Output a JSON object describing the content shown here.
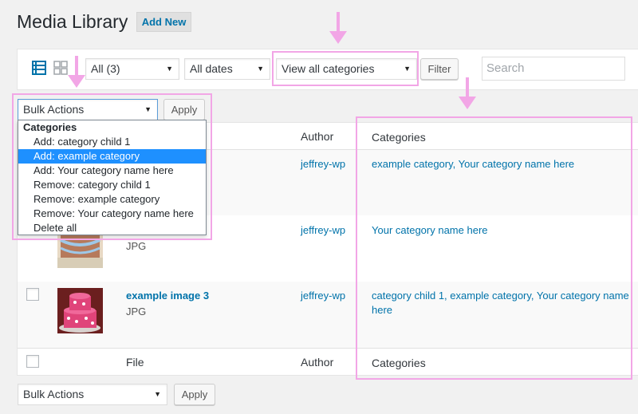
{
  "header": {
    "title": "Media Library",
    "add_new_label": "Add New"
  },
  "toolbar": {
    "type_filter": "All (3)",
    "date_filter": "All dates",
    "category_filter": "View all categories",
    "filter_button": "Filter",
    "search_placeholder": "Search"
  },
  "bulk_top": {
    "selected": "Bulk Actions",
    "apply_label": "Apply",
    "menu": {
      "group_label": "Categories",
      "items": [
        "Add: category child 1",
        "Add: example category",
        "Add: Your category name here",
        "Remove: category child 1",
        "Remove: example category",
        "Remove: Your category name here",
        "Delete all"
      ],
      "selected_index": 1
    }
  },
  "table": {
    "columns": {
      "file": "File",
      "author": "Author",
      "categories": "Categories"
    },
    "rows": [
      {
        "author": "jeffrey-wp",
        "categories": "example category, Your category name here"
      },
      {
        "title": "",
        "type": "JPG",
        "author": "jeffrey-wp",
        "categories": "Your category name here"
      },
      {
        "title": "example image 3",
        "type": "JPG",
        "author": "jeffrey-wp",
        "categories_line1": "category child 1, example category, Your category name",
        "categories_line2": "here"
      }
    ]
  },
  "bulk_bottom": {
    "selected": "Bulk Actions",
    "apply_label": "Apply"
  },
  "colors": {
    "accent": "#0073aa",
    "highlight": "#f2a6e6",
    "selection": "#1e90ff"
  }
}
